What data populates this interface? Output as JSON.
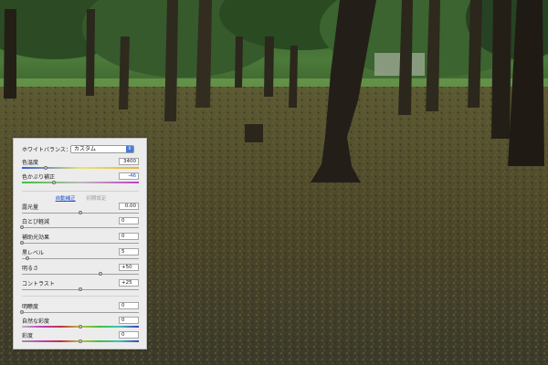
{
  "white_balance": {
    "label": "ホワイトバランス：",
    "selected": "カスタム",
    "arrow_icon": "updown-arrows-icon"
  },
  "controls": [
    {
      "key": "temperature",
      "label": "色温度",
      "value": "3400",
      "level": 0.2
    },
    {
      "key": "tint",
      "label": "色かぶり補正",
      "value": "-46",
      "level": 0.27
    }
  ],
  "links": {
    "auto": "自動補正",
    "default": "初期設定"
  },
  "tone_controls": [
    {
      "key": "exposure",
      "label": "露光量",
      "value": "0.00",
      "level": 0.5
    },
    {
      "key": "recovery",
      "label": "白とび軽減",
      "value": "0",
      "level": 0.0
    },
    {
      "key": "fill_light",
      "label": "補助光効果",
      "value": "0",
      "level": 0.0
    },
    {
      "key": "blacks",
      "label": "黒レベル",
      "value": "5",
      "level": 0.05
    },
    {
      "key": "brightness",
      "label": "明るさ",
      "value": "+50",
      "level": 0.67
    },
    {
      "key": "contrast",
      "label": "コントラスト",
      "value": "+25",
      "level": 0.5
    }
  ],
  "presence_controls": [
    {
      "key": "clarity",
      "label": "明瞭度",
      "value": "0",
      "level": 0.0
    },
    {
      "key": "vibrance",
      "label": "自然な彩度",
      "value": "0",
      "level": 0.5
    },
    {
      "key": "saturation",
      "label": "彩度",
      "value": "0",
      "level": 0.5
    }
  ],
  "colors": {
    "accent_blue": "#4a7ad8",
    "link_blue": "#1a4fd0",
    "panel_bg": "#ececec"
  }
}
